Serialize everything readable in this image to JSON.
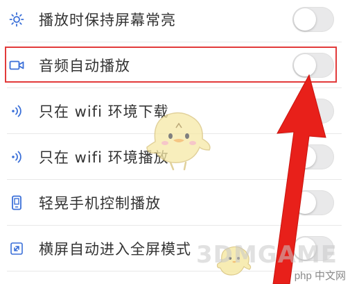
{
  "settings": {
    "items": [
      {
        "icon": "sun-icon",
        "label": "播放时保持屏幕常亮",
        "enabled": false
      },
      {
        "icon": "video-camera-icon",
        "label": "音频自动播放",
        "enabled": false
      },
      {
        "icon": "wifi-signal-icon",
        "label": "只在 wifi 环境下载",
        "enabled": false
      },
      {
        "icon": "wifi-signal-icon",
        "label": "只在 wifi 环境播放",
        "enabled": false
      },
      {
        "icon": "phone-icon",
        "label": "轻晃手机控制播放",
        "enabled": false
      },
      {
        "icon": "fullscreen-icon",
        "label": "横屏自动进入全屏模式",
        "enabled": false
      }
    ]
  },
  "watermark": {
    "brand": "3DMGAME",
    "site": "php 中文网"
  },
  "colors": {
    "highlight": "#e23a3a",
    "arrow": "#e8201a",
    "icon": "#3a6fd8"
  }
}
